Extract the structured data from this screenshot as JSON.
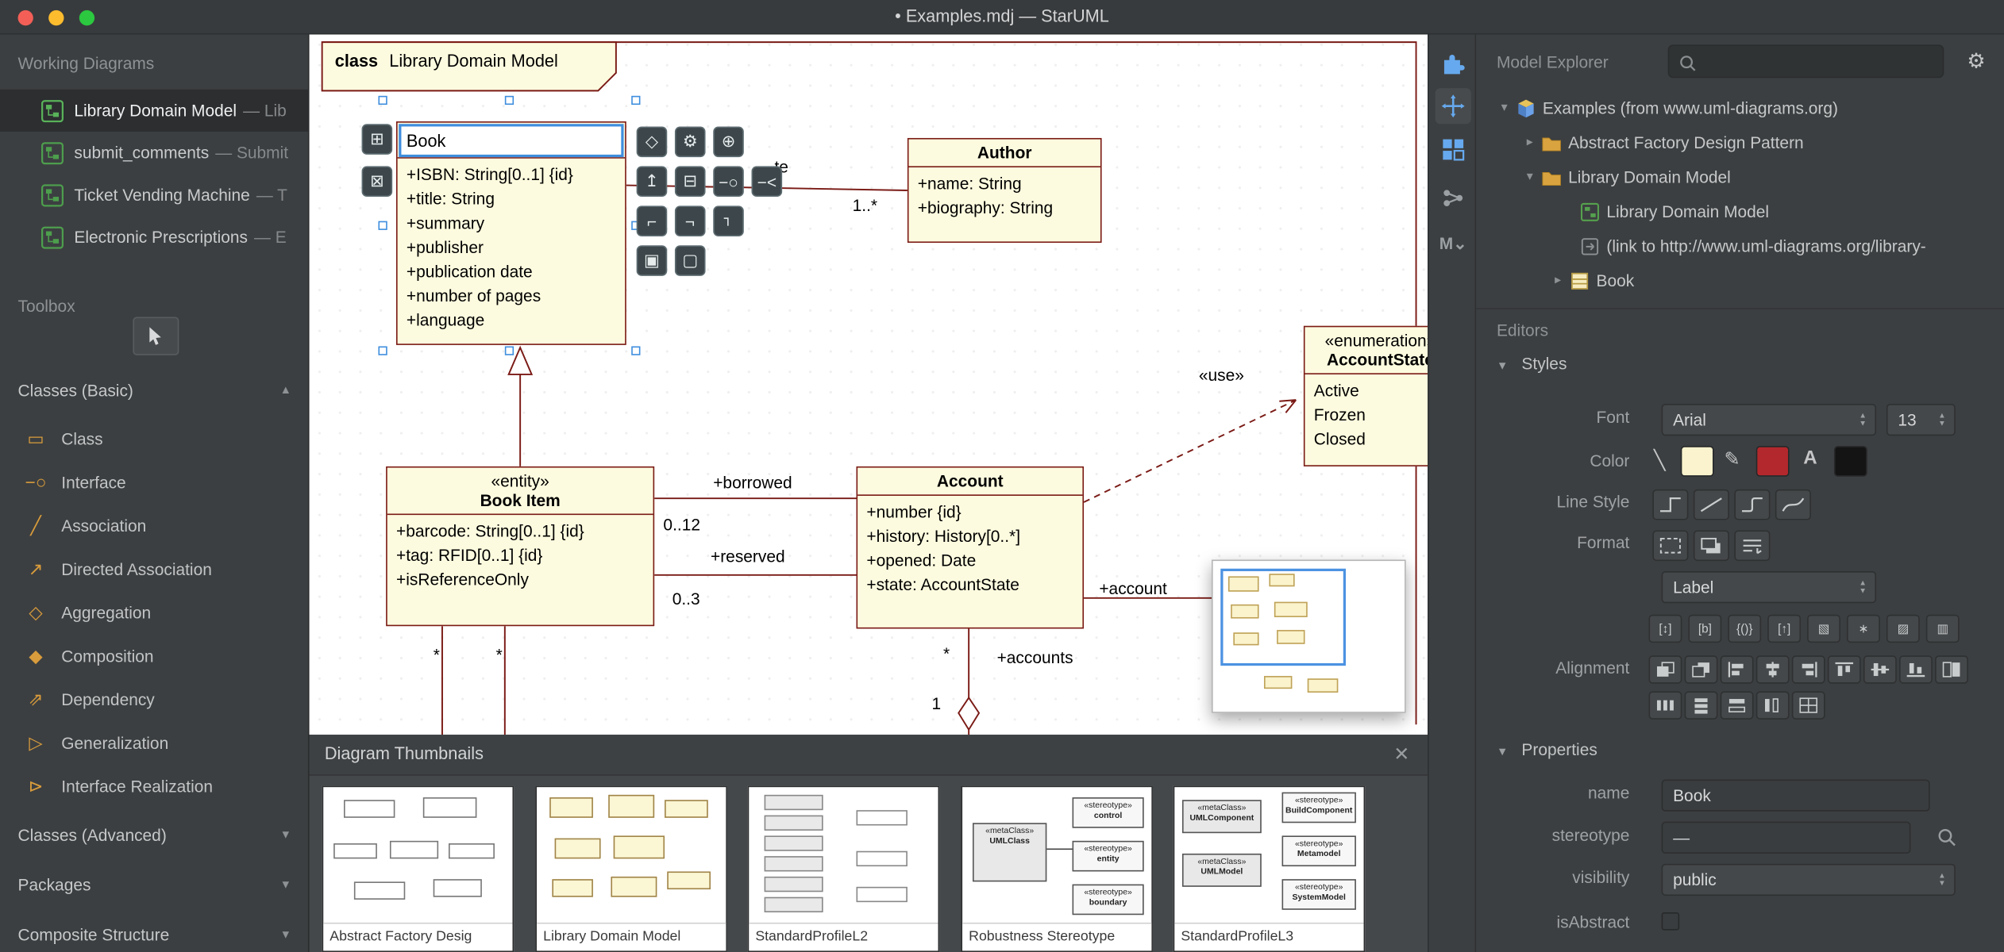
{
  "titlebar": {
    "title": "• Examples.mdj — StarUML"
  },
  "colors": {
    "selection_blue": "#3e8ede",
    "uml_fill": "#fdfbdf",
    "uml_stroke": "#7a1a15",
    "fill_color_swatch": "#fbf3cd",
    "line_color_swatch": "#b3282c",
    "font_color_swatch": "#141414",
    "toolbox_icon": "#d99c3c",
    "dock_accent": "#66a9ee"
  },
  "sidebar": {
    "working_diagrams_header": "Working Diagrams",
    "diagrams": [
      {
        "label": "Library Domain Model",
        "suffix": "— Lib"
      },
      {
        "label": "submit_comments",
        "suffix": "— Submit"
      },
      {
        "label": "Ticket Vending Machine",
        "suffix": "— T"
      },
      {
        "label": "Electronic Prescriptions",
        "suffix": "— E"
      }
    ],
    "toolbox_header": "Toolbox",
    "sections": [
      {
        "label": "Classes (Basic)",
        "arrow": "▲"
      },
      {
        "label": "Classes (Advanced)",
        "arrow": "▼"
      },
      {
        "label": "Packages",
        "arrow": "▼"
      },
      {
        "label": "Composite Structure",
        "arrow": "▼"
      }
    ],
    "tools": [
      {
        "label": "Class",
        "glyph": "▭"
      },
      {
        "label": "Interface",
        "glyph": "−○"
      },
      {
        "label": "Association",
        "glyph": "╱"
      },
      {
        "label": "Directed Association",
        "glyph": "↗"
      },
      {
        "label": "Aggregation",
        "glyph": "◇"
      },
      {
        "label": "Composition",
        "glyph": "◆"
      },
      {
        "label": "Dependency",
        "glyph": "⇗"
      },
      {
        "label": "Generalization",
        "glyph": "▷"
      },
      {
        "label": "Interface Realization",
        "glyph": "⊳"
      }
    ]
  },
  "canvas": {
    "frame_keyword": "class",
    "frame_name": "Library Domain Model",
    "book": {
      "edit_value": "Book",
      "attributes": [
        "+ISBN: String[0..1] {id}",
        "+title: String",
        "+summary",
        "+publisher",
        "+publication date",
        "+number of pages",
        "+language"
      ]
    },
    "author": {
      "name": "Author",
      "attributes": [
        "+name: String",
        "+biography: String"
      ]
    },
    "account_state": {
      "stereotype": "«enumeration»",
      "name": "AccountState",
      "literals": [
        "Active",
        "Frozen",
        "Closed"
      ]
    },
    "book_item": {
      "stereotype": "«entity»",
      "name": "Book Item",
      "attributes": [
        "+barcode: String[0..1] {id}",
        "+tag: RFID[0..1] {id}",
        "+isReferenceOnly"
      ]
    },
    "account": {
      "name": "Account",
      "attributes": [
        "+number {id}",
        "+history: History[0..*]",
        "+opened: Date",
        "+state: AccountState"
      ]
    },
    "labels": {
      "wrote_partial": "te",
      "author_mult": "1..*",
      "borrowed": "+borrowed",
      "borrowed_mult": "0..12",
      "reserved": "+reserved",
      "reserved_mult": "0..3",
      "copies_mult_a": "*",
      "copies_mult_b": "*",
      "account_mult": "*",
      "accounts_role": "+accounts",
      "account_one": "1",
      "account_role": "+account",
      "use_keyword": "«use»"
    },
    "quick_glyphs": [
      "⊞",
      "⊠",
      "◇",
      "⚙",
      "⊕",
      "↥",
      "⊟",
      "−○",
      "−<",
      "⌐",
      "⌐",
      "⌐",
      "▣",
      "▢"
    ]
  },
  "thumbnails": {
    "header": "Diagram Thumbnails",
    "close_glyph": "✕",
    "cards": [
      {
        "label": "Abstract Factory Desig"
      },
      {
        "label": "Library Domain Model"
      },
      {
        "label": "StandardProfileL2"
      },
      {
        "label": "Robustness Stereotype",
        "mini": [
          {
            "kw": "«metaClass»",
            "name": "UMLClass"
          },
          {
            "kw": "«stereotype»",
            "name": "control"
          },
          {
            "kw": "«stereotype»",
            "name": "entity"
          },
          {
            "kw": "«stereotype»",
            "name": "boundary"
          }
        ]
      },
      {
        "label": "StandardProfileL3",
        "mini": [
          {
            "kw": "«metaClass»",
            "name": "UMLComponent"
          },
          {
            "kw": "«metaClass»",
            "name": "UMLModel"
          },
          {
            "kw": "«stereotype»",
            "name": "BuildComponent"
          },
          {
            "kw": "«stereotype»",
            "name": "Metamodel"
          },
          {
            "kw": "«stereotype»",
            "name": "SystemModel"
          }
        ]
      }
    ]
  },
  "dock": {
    "markdown_glyph": "M⌄"
  },
  "explorer": {
    "header": "Model Explorer",
    "settings_glyph": "⚙",
    "tree": [
      {
        "label": "Examples (from www.uml-diagrams.org)",
        "arrow": "▾"
      },
      {
        "label": "Abstract Factory Design Pattern",
        "arrow": "▸"
      },
      {
        "label": "Library Domain Model",
        "arrow": "▾"
      },
      {
        "label": "Library Domain Model",
        "arrow": ""
      },
      {
        "label": "(link to http://www.uml-diagrams.org/library-",
        "arrow": ""
      },
      {
        "label": "Book",
        "arrow": "▸"
      }
    ]
  },
  "editors": {
    "header": "Editors",
    "styles_header": "Styles",
    "font_label": "Font",
    "font_value": "Arial",
    "font_size": "13",
    "color_label": "Color",
    "line_style_label": "Line Style",
    "format_label": "Format",
    "format_select_value": "Label",
    "toggles": [
      "[↕]",
      "[b]",
      "{()}",
      "[↑]",
      "▧",
      "∗",
      "▨",
      "▥"
    ],
    "alignment_label": "Alignment",
    "properties_header": "Properties",
    "prop_name_label": "name",
    "prop_name_value": "Book",
    "prop_stereotype_label": "stereotype",
    "prop_stereotype_value": "—",
    "prop_visibility_label": "visibility",
    "prop_visibility_value": "public",
    "prop_isabstract_label": "isAbstract"
  }
}
